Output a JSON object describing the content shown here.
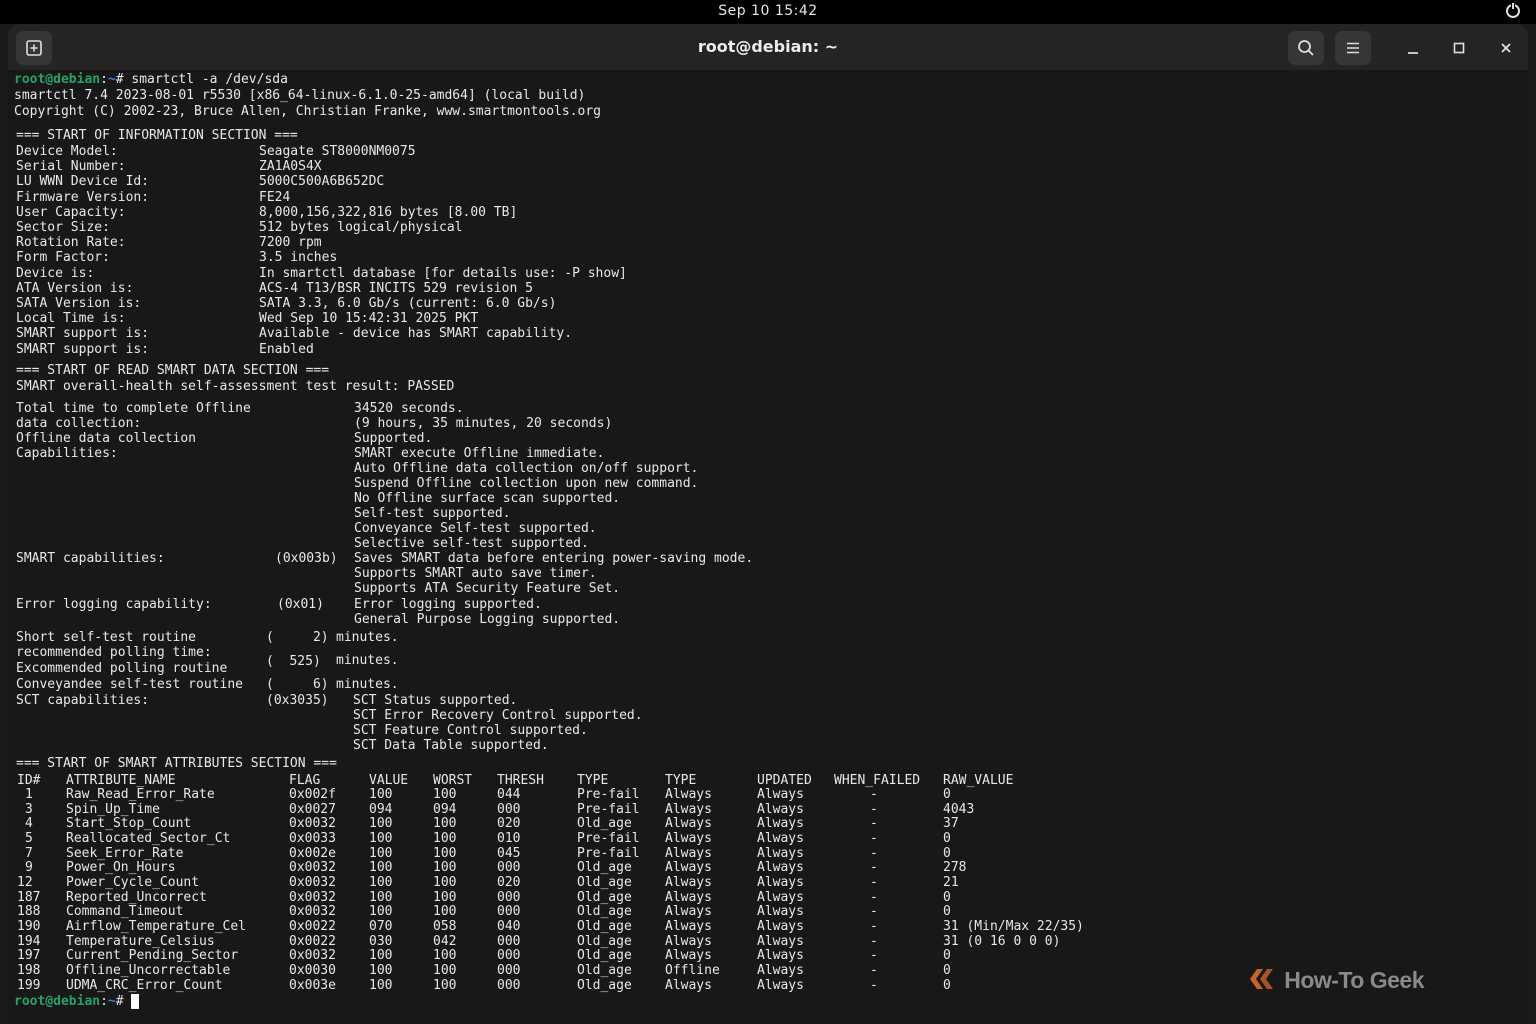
{
  "system_bar": {
    "clock": "Sep 10 15:42"
  },
  "window": {
    "title": "root@debian: ~"
  },
  "prompt": {
    "user_host": "root@debian",
    "path": "~",
    "symbol": "#"
  },
  "command": "smartctl -a /dev/sda",
  "banner": [
    "smartctl 7.4 2023-08-01 r5530 [x86_64-linux-6.1.0-25-amd64] (local build)",
    "Copyright (C) 2002-23, Bruce Allen, Christian Franke, www.smartmontools.org"
  ],
  "info_section": {
    "header": "=== START OF INFORMATION SECTION ===",
    "rows": [
      [
        "Device Model:",
        "Seagate ST8000NM0075"
      ],
      [
        "Serial Number:",
        "ZA1A0S4X"
      ],
      [
        "LU WWN Device Id:",
        "5000C500A6B652DC"
      ],
      [
        "Firmware Version:",
        "FE24"
      ],
      [
        "User Capacity:",
        "8,000,156,322,816 bytes [8.00 TB]"
      ],
      [
        "Sector Size:",
        "512 bytes logical/physical"
      ],
      [
        "Rotation Rate:",
        "7200 rpm"
      ],
      [
        "Form Factor:",
        "3.5 inches"
      ],
      [
        "Device is:",
        "In smartctl database [for details use: -P show]"
      ],
      [
        "ATA Version is:",
        "ACS-4 T13/BSR INCITS 529 revision 5"
      ],
      [
        "SATA Version is:",
        "SATA 3.3, 6.0 Gb/s (current: 6.0 Gb/s)"
      ],
      [
        "Local Time is:",
        "Wed Sep 10 15:42:31 2025 PKT"
      ],
      [
        "SMART support is:",
        "Available - device has SMART capability."
      ],
      [
        "SMART support is:",
        "Enabled"
      ]
    ]
  },
  "read_section": {
    "header": "=== START OF READ SMART DATA SECTION ===",
    "health": "SMART overall-health self-assessment test result: PASSED",
    "lines": [
      [
        "Total time to complete Offline",
        "",
        "34520 seconds."
      ],
      [
        "data collection:",
        "",
        "(9 hours, 35 minutes, 20 seconds)"
      ],
      [
        "Offline data collection",
        "",
        "Supported."
      ],
      [
        "Capabilities:",
        "",
        "SMART execute Offline immediate."
      ],
      [
        "",
        "",
        "Auto Offline data collection on/off support."
      ],
      [
        "",
        "",
        "Suspend Offline collection upon new command."
      ],
      [
        "",
        "",
        "No Offline surface scan supported."
      ],
      [
        "",
        "",
        "Self-test supported."
      ],
      [
        "",
        "",
        "Conveyance Self-test supported."
      ],
      [
        "",
        "",
        "Selective self-test supported."
      ],
      [
        "SMART capabilities:",
        "(0x003b)",
        "Saves SMART data before entering power-saving mode."
      ],
      [
        "",
        "",
        "Supports SMART auto save timer."
      ],
      [
        "",
        "",
        "Supports ATA Security Feature Set."
      ],
      [
        "Error logging capability:",
        "(0x01)",
        "Error logging supported."
      ],
      [
        "",
        "",
        "General Purpose Logging supported."
      ],
      [
        "Short self-test routine",
        "(     2)",
        "minutes."
      ],
      [
        "recommended polling time:",
        "",
        ""
      ],
      [
        "Excommended polling routine",
        "(  525)",
        "minutes."
      ],
      [
        "Conveyandee self-test routine",
        "(     6)",
        "minutes."
      ],
      [
        "SCT capabilities:",
        "(0x3035)",
        "SCT Status supported."
      ],
      [
        "",
        "",
        "SCT Error Recovery Control supported."
      ],
      [
        "",
        "",
        "SCT Feature Control supported."
      ],
      [
        "",
        "",
        "SCT Data Table supported."
      ]
    ]
  },
  "attributes_section": {
    "header": "=== START OF SMART ATTRIBUTES SECTION ===",
    "columns": [
      "ID#",
      "ATTRIBUTE_NAME",
      "FLAG",
      "VALUE",
      "WORST",
      "THRESH",
      "TYPE",
      "TYPE",
      "UPDATED",
      "WHEN_FAILED",
      "RAW_VALUE"
    ],
    "rows": [
      [
        "1",
        "Raw_Read_Error_Rate",
        "0x002f",
        "100",
        "100",
        "044",
        "Pre-fail",
        "Always",
        "Always",
        "-",
        "0"
      ],
      [
        "3",
        "Spin_Up_Time",
        "0x0027",
        "094",
        "094",
        "000",
        "Pre-fail",
        "Always",
        "Always",
        "-",
        "4043"
      ],
      [
        "4",
        "Start_Stop_Count",
        "0x0032",
        "100",
        "100",
        "020",
        "Old_age",
        "Always",
        "Always",
        "-",
        "37"
      ],
      [
        "5",
        "Reallocated_Sector_Ct",
        "0x0033",
        "100",
        "100",
        "010",
        "Pre-fail",
        "Always",
        "Always",
        "-",
        "0"
      ],
      [
        "7",
        "Seek_Error_Rate",
        "0x002e",
        "100",
        "100",
        "045",
        "Pre-fail",
        "Always",
        "Always",
        "-",
        "0"
      ],
      [
        "9",
        "Power_On_Hours",
        "0x0032",
        "100",
        "100",
        "000",
        "Old_age",
        "Always",
        "Always",
        "-",
        "278"
      ],
      [
        "12",
        "Power_Cycle_Count",
        "0x0032",
        "100",
        "100",
        "020",
        "Old_age",
        "Always",
        "Always",
        "-",
        "21"
      ],
      [
        "187",
        "Reported_Uncorrect",
        "0x0032",
        "100",
        "100",
        "000",
        "Old_age",
        "Always",
        "Always",
        "-",
        "0"
      ],
      [
        "188",
        "Command_Timeout",
        "0x0032",
        "100",
        "100",
        "000",
        "Old_age",
        "Always",
        "Always",
        "-",
        "0"
      ],
      [
        "190",
        "Airflow_Temperature_Cel",
        "0x0022",
        "070",
        "058",
        "040",
        "Old_age",
        "Always",
        "Always",
        "-",
        "31 (Min/Max 22/35)"
      ],
      [
        "194",
        "Temperature_Celsius",
        "0x0022",
        "030",
        "042",
        "000",
        "Old_age",
        "Always",
        "Always",
        "-",
        "31 (0 16 0 0 0)"
      ],
      [
        "197",
        "Current_Pending_Sector",
        "0x0032",
        "100",
        "100",
        "000",
        "Old_age",
        "Always",
        "Always",
        "-",
        "0"
      ],
      [
        "198",
        "Offline_Uncorrectable",
        "0x0030",
        "100",
        "100",
        "000",
        "Old_age",
        "Offline",
        "Always",
        "-",
        "0"
      ],
      [
        "199",
        "UDMA_CRC_Error_Count",
        "0x003e",
        "100",
        "100",
        "000",
        "Old_age",
        "Always",
        "Always",
        "-",
        "0"
      ]
    ]
  },
  "watermark": "How-To Geek",
  "icons": [
    "new-tab-icon",
    "search-icon",
    "menu-icon",
    "minimize-icon",
    "maximize-icon",
    "close-icon",
    "power-icon"
  ],
  "colors": {
    "prompt_user": "#26a269",
    "prompt_path": "#3584e4",
    "terminal_bg": "#181818",
    "header_bg": "#242424"
  }
}
